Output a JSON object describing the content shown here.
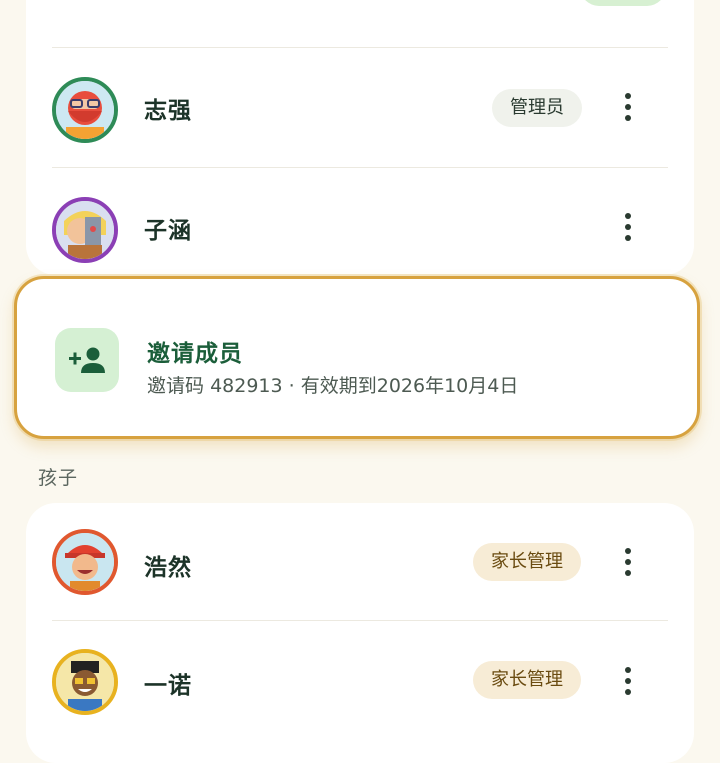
{
  "family_members": [
    {
      "name": "",
      "badge": ""
    },
    {
      "name": "志强",
      "badge": "管理员"
    },
    {
      "name": "子涵",
      "badge": ""
    }
  ],
  "invite": {
    "title": "邀请成员",
    "code_label": "邀请码",
    "code": "482913",
    "separator": "·",
    "validity": "有效期到2026年10月4日",
    "icon": "person-add-icon"
  },
  "children_section": {
    "title": "孩子",
    "members": [
      {
        "name": "浩然",
        "badge": "家长管理"
      },
      {
        "name": "一诺",
        "badge": "家长管理"
      }
    ]
  },
  "colors": {
    "background": "#fbf8ef",
    "accent_green": "#1b5e3a",
    "invite_border": "#d7a23f",
    "admin_badge_bg": "#f0f2ec",
    "parent_badge_bg": "#f7ecd6"
  }
}
